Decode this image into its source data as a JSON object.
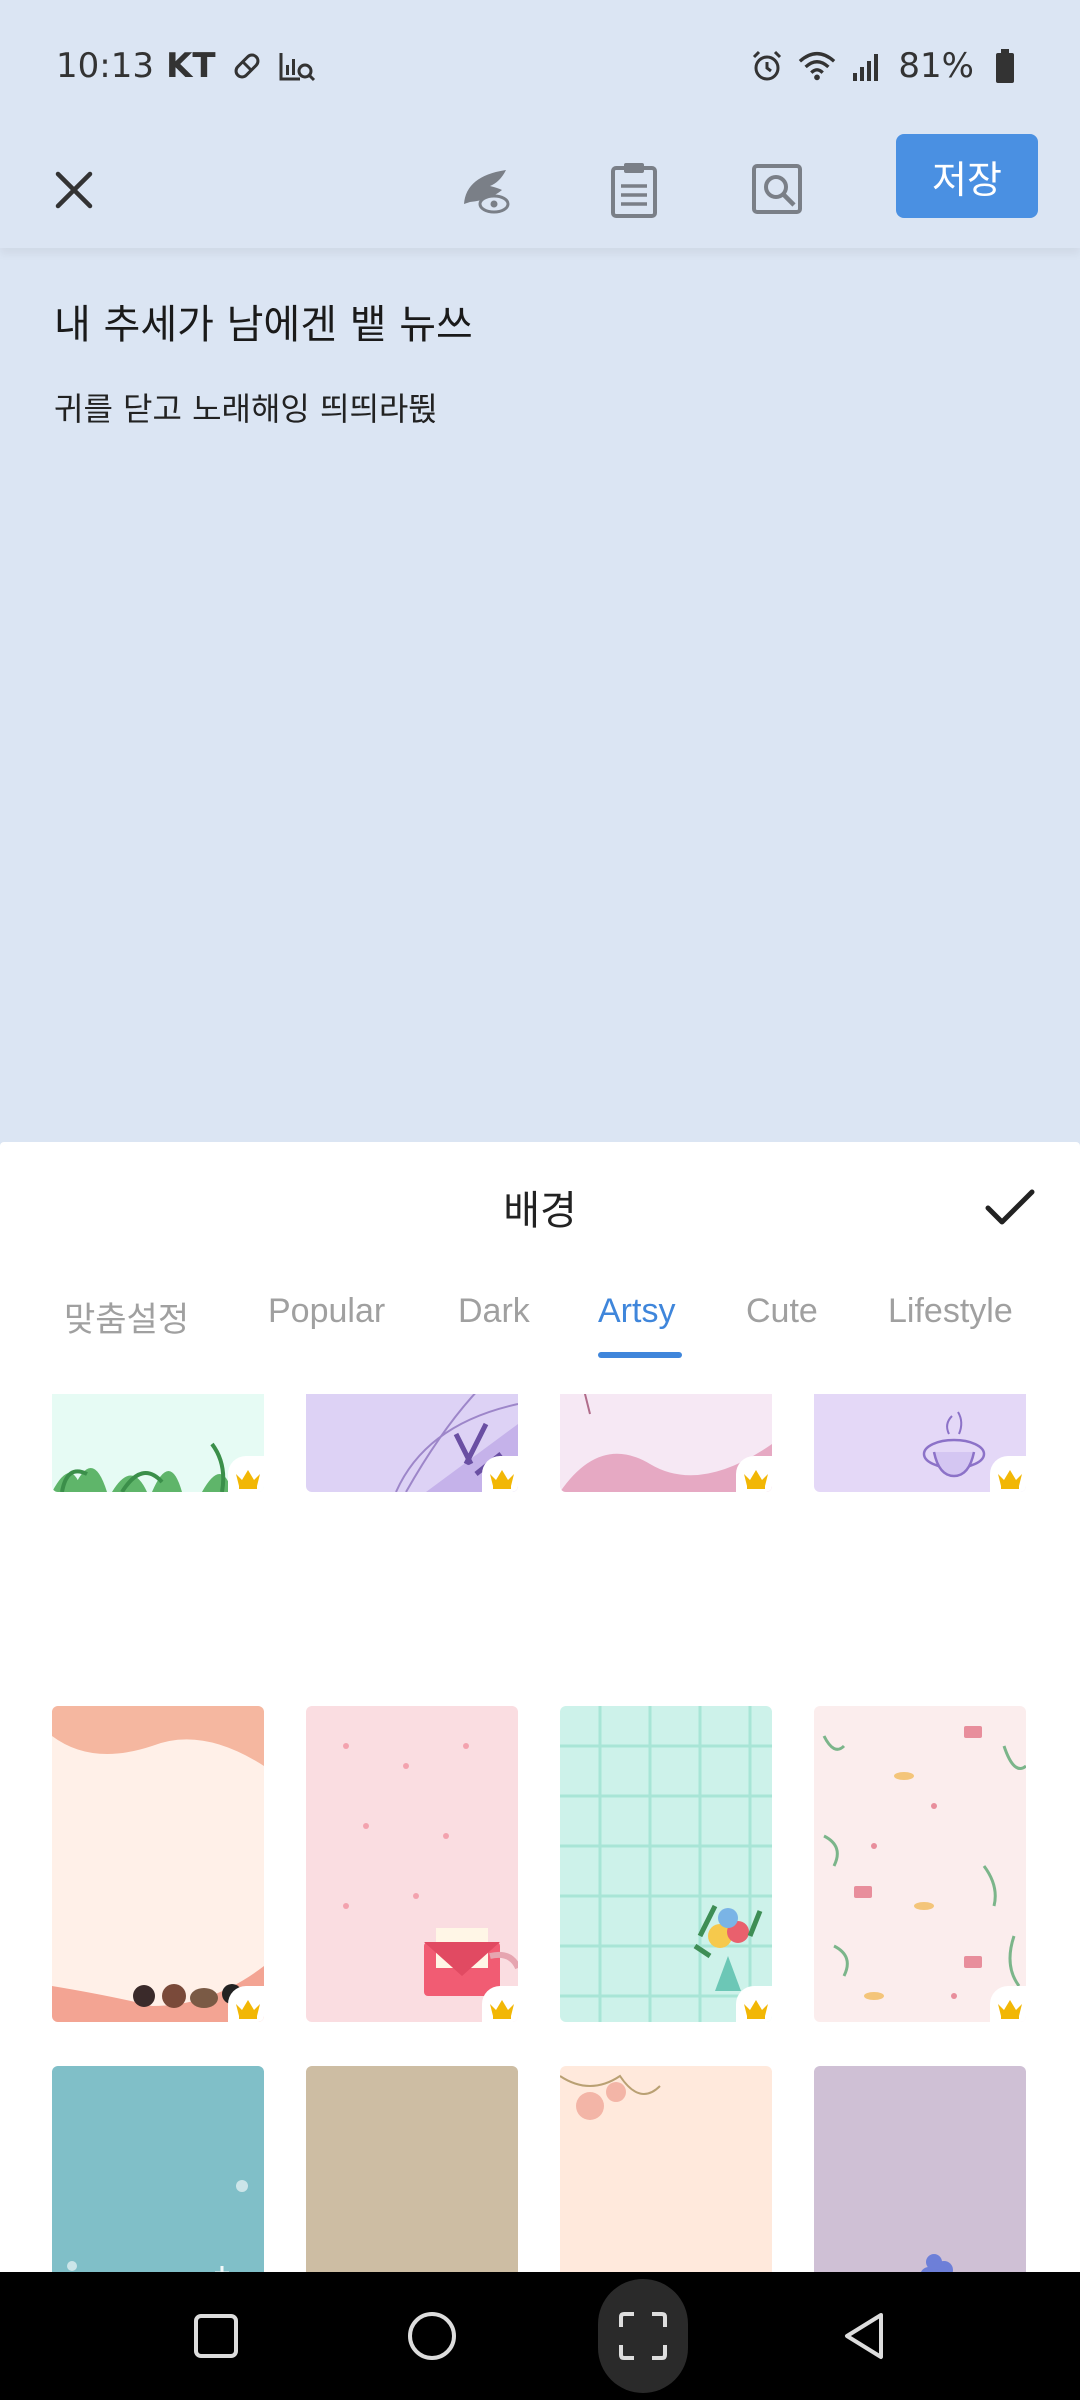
{
  "status": {
    "time": "10:13",
    "carrier": "KT",
    "battery": "81%"
  },
  "toolbar": {
    "save_label": "저장"
  },
  "note": {
    "title": "내 추세가 남에겐 뱉 뉴쓰",
    "body": "귀를 닫고 노래해잉 띄띄라뛵"
  },
  "sheet": {
    "title": "배경",
    "tabs": [
      {
        "label": "맞춤설정",
        "active": false
      },
      {
        "label": "Popular",
        "active": false
      },
      {
        "label": "Dark",
        "active": false
      },
      {
        "label": "Artsy",
        "active": true
      },
      {
        "label": "Cute",
        "active": false
      },
      {
        "label": "Lifestyle",
        "active": false
      }
    ]
  },
  "backgrounds": [
    {
      "name": "leaves",
      "color": "#e6fbf4",
      "premium": true
    },
    {
      "name": "purple-lines",
      "color": "#ddd2f5",
      "premium": true
    },
    {
      "name": "pink-flower-wave",
      "color": "#f6e8f4",
      "premium": true
    },
    {
      "name": "teacup",
      "color": "#e4d8f7",
      "premium": true
    },
    {
      "name": "peach-animals",
      "color": "#fff0e8",
      "premium": true
    },
    {
      "name": "pink-letter",
      "color": "#fadde1",
      "premium": true
    },
    {
      "name": "mint-grid-bouquet",
      "color": "#cdf2ea",
      "premium": true
    },
    {
      "name": "pink-envelopes",
      "color": "#fbeded",
      "premium": true
    },
    {
      "name": "teal-snow",
      "color": "#80bfc8",
      "premium": true
    },
    {
      "name": "kraft-yellow-flower",
      "color": "#cdbda3",
      "premium": true
    },
    {
      "name": "peach-bouquet",
      "color": "#ffe9dc",
      "premium": true
    },
    {
      "name": "lilac-blue-flower",
      "color": "#cfc0d5",
      "premium": true
    }
  ],
  "colors": {
    "accent": "#4a90e2",
    "tab_active": "#3f86db",
    "crown": "#f2b705",
    "page_bg": "#dbe5f3"
  }
}
